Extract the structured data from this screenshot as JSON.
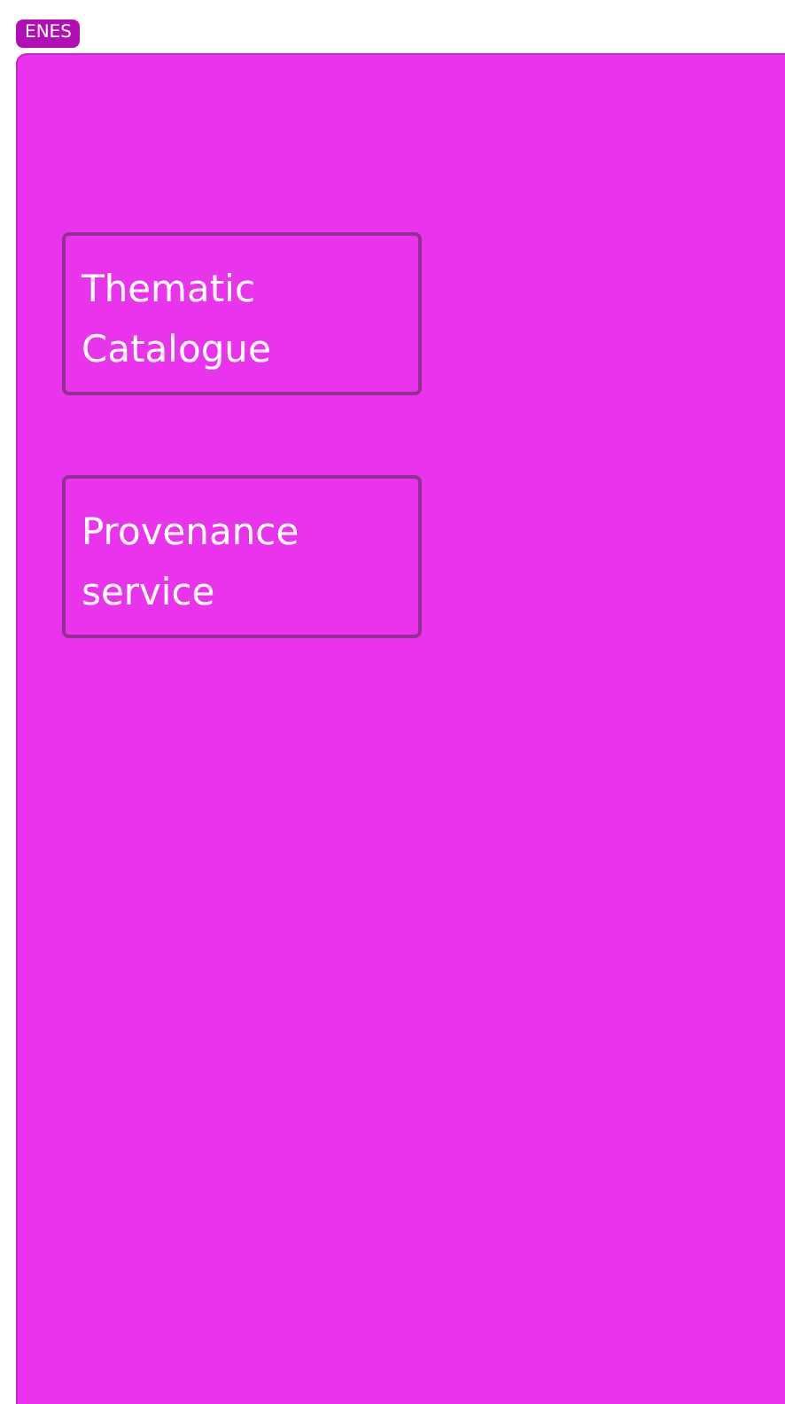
{
  "badge": {
    "label": "ENES"
  },
  "cards": [
    {
      "label": "Thematic Catalogue"
    },
    {
      "label": "Provenance service"
    }
  ]
}
